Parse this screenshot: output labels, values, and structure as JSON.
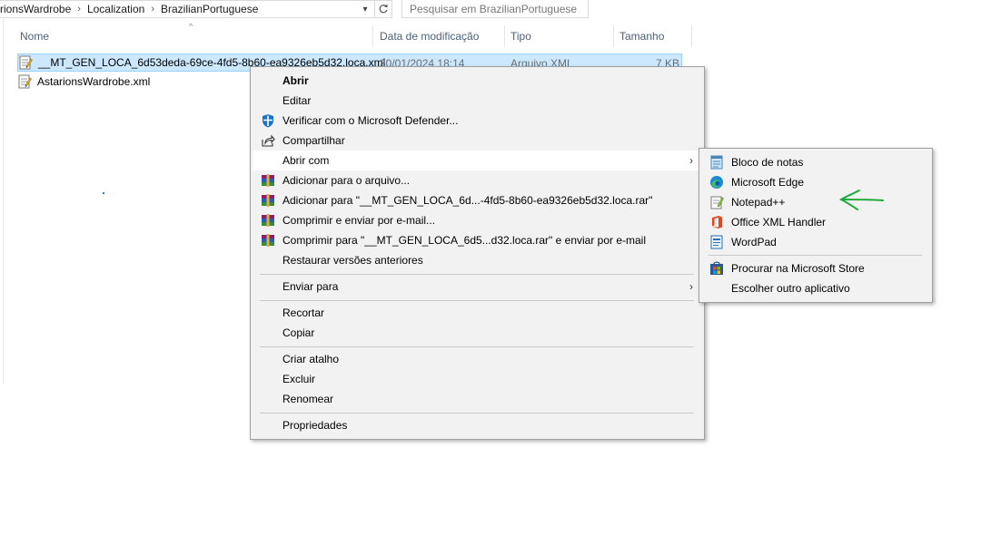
{
  "address_bar": {
    "crumbs": [
      "rionsWardrobe",
      "Localization",
      "BrazilianPortuguese"
    ],
    "search_placeholder": "Pesquisar em BrazilianPortuguese"
  },
  "columns": {
    "name": "Nome",
    "modified": "Data de modificação",
    "type": "Tipo",
    "size": "Tamanho"
  },
  "files": [
    {
      "name": "__MT_GEN_LOCA_6d53deda-69ce-4fd5-8b60-ea9326eb5d32.loca.xml",
      "modified": "30/01/2024 18:14",
      "type": "Arquivo XML",
      "size": "7 KB"
    },
    {
      "name": "AstarionsWardrobe.xml"
    }
  ],
  "context_menu": {
    "items": [
      {
        "label": "Abrir"
      },
      {
        "label": "Editar"
      },
      {
        "label": "Verificar com o Microsoft Defender...",
        "icon": "defender-icon"
      },
      {
        "label": "Compartilhar",
        "icon": "share-icon"
      },
      {
        "label": "Abrir com"
      },
      {
        "label": "Adicionar para o arquivo...",
        "icon": "winrar-icon"
      },
      {
        "label": "Adicionar para \"__MT_GEN_LOCA_6d...-4fd5-8b60-ea9326eb5d32.loca.rar\"",
        "icon": "winrar-icon"
      },
      {
        "label": "Comprimir e enviar por e-mail...",
        "icon": "winrar-icon"
      },
      {
        "label": "Comprimir para \"__MT_GEN_LOCA_6d5...d32.loca.rar\" e enviar por e-mail",
        "icon": "winrar-icon"
      },
      {
        "label": "Restaurar versões anteriores"
      },
      {
        "label": "Enviar para"
      },
      {
        "label": "Recortar"
      },
      {
        "label": "Copiar"
      },
      {
        "label": "Criar atalho"
      },
      {
        "label": "Excluir"
      },
      {
        "label": "Renomear"
      },
      {
        "label": "Propriedades"
      }
    ],
    "submenu_arrow": ">"
  },
  "open_with_menu": {
    "items": [
      {
        "label": "Bloco de notas",
        "icon": "notepad-icon"
      },
      {
        "label": "Microsoft Edge",
        "icon": "edge-icon"
      },
      {
        "label": "Notepad++",
        "icon": "notepadpp-icon"
      },
      {
        "label": "Office XML Handler",
        "icon": "office-icon"
      },
      {
        "label": "WordPad",
        "icon": "wordpad-icon"
      },
      {
        "label": "Procurar na Microsoft Store",
        "icon": "store-icon"
      },
      {
        "label": "Escolher outro aplicativo"
      }
    ]
  },
  "colors": {
    "selection_bg": "#cce8ff",
    "menu_bg": "#f2f2f2",
    "annotation": "#1faa3c"
  }
}
